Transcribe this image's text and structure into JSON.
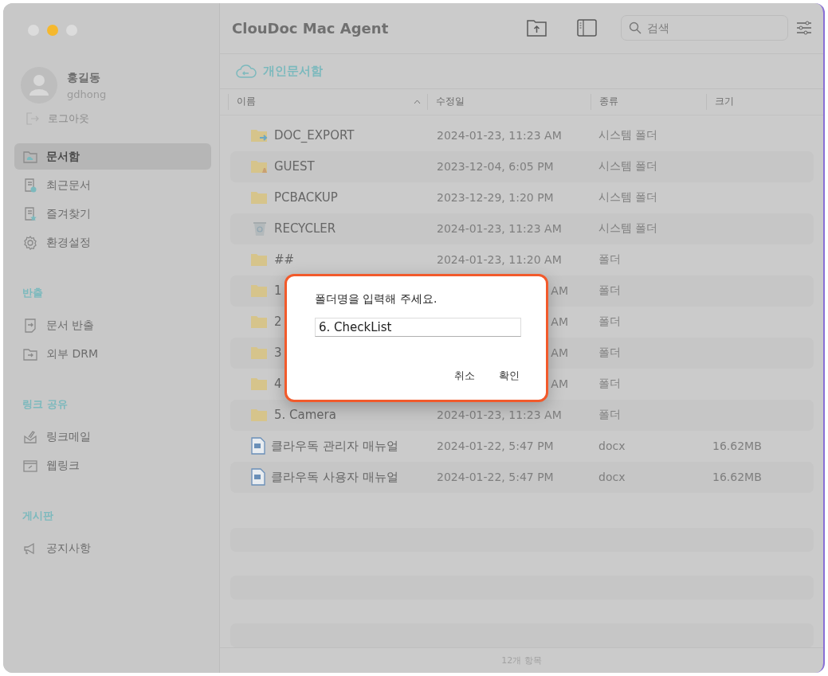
{
  "window": {
    "title": "ClouDoc Mac Agent"
  },
  "user": {
    "name": "홍길동",
    "id": "gdhong",
    "logout": "로그아웃"
  },
  "sidebar": {
    "items": [
      {
        "label": "문서함",
        "selected": true
      },
      {
        "label": "최근문서",
        "selected": false
      },
      {
        "label": "즐겨찾기",
        "selected": false
      },
      {
        "label": "환경설정",
        "selected": false
      }
    ],
    "sections": [
      {
        "title": "반출",
        "items": [
          {
            "label": "문서 반출",
            "selected": false
          },
          {
            "label": "외부 DRM",
            "selected": false
          }
        ]
      },
      {
        "title": "링크 공유",
        "items": [
          {
            "label": "링크메일",
            "selected": false
          },
          {
            "label": "웹링크",
            "selected": false
          }
        ]
      },
      {
        "title": "게시판",
        "items": [
          {
            "label": "공지사항",
            "selected": false
          }
        ]
      }
    ]
  },
  "search": {
    "placeholder": "검색"
  },
  "breadcrumb": "개인문서함",
  "table": {
    "columns": [
      "이름",
      "수정일",
      "종류",
      "크기"
    ],
    "rows": [
      {
        "kind": "export",
        "name": "DOC_EXPORT",
        "modified": "2024-01-23, 11:23 AM",
        "type": "시스템 폴더",
        "covered": false
      },
      {
        "kind": "guest",
        "name": "GUEST",
        "modified": "2023-12-04, 6:05 PM",
        "type": "시스템 폴더",
        "covered": false
      },
      {
        "kind": "folder",
        "name": "PCBACKUP",
        "modified": "2023-12-29, 1:20 PM",
        "type": "시스템 폴더",
        "covered": false
      },
      {
        "kind": "recycler",
        "name": "RECYCLER",
        "modified": "2024-01-23, 11:23 AM",
        "type": "시스템 폴더",
        "covered": false
      },
      {
        "kind": "folder",
        "name": "##",
        "modified": "2024-01-23, 11:20 AM",
        "type": "폴더",
        "covered": false
      },
      {
        "kind": "folder",
        "name": "1",
        "modified": "AM",
        "type": "폴더",
        "covered": true
      },
      {
        "kind": "folder",
        "name": "2",
        "modified": "AM",
        "type": "폴더",
        "covered": true
      },
      {
        "kind": "folder",
        "name": "3",
        "modified": "AM",
        "type": "폴더",
        "covered": true
      },
      {
        "kind": "folder",
        "name": "4",
        "modified": "AM",
        "type": "폴더",
        "covered": true
      },
      {
        "kind": "folder",
        "name": "5. Camera",
        "modified": "2024-01-23, 11:23 AM",
        "type": "폴더",
        "covered": false
      },
      {
        "kind": "doc",
        "name": "클라우독 관리자 매뉴얼",
        "modified": "2024-01-22, 5:47 PM",
        "type": "docx",
        "size": "16.62MB",
        "covered": false
      },
      {
        "kind": "doc",
        "name": "클라우독 사용자 매뉴얼",
        "modified": "2024-01-22, 5:47 PM",
        "type": "docx",
        "size": "16.62MB",
        "covered": false
      }
    ]
  },
  "status_bar": "12개 항목",
  "dialog": {
    "message": "폴더명을 입력해 주세요.",
    "value": "6. CheckList",
    "buttons": [
      "취소",
      "확인"
    ]
  }
}
